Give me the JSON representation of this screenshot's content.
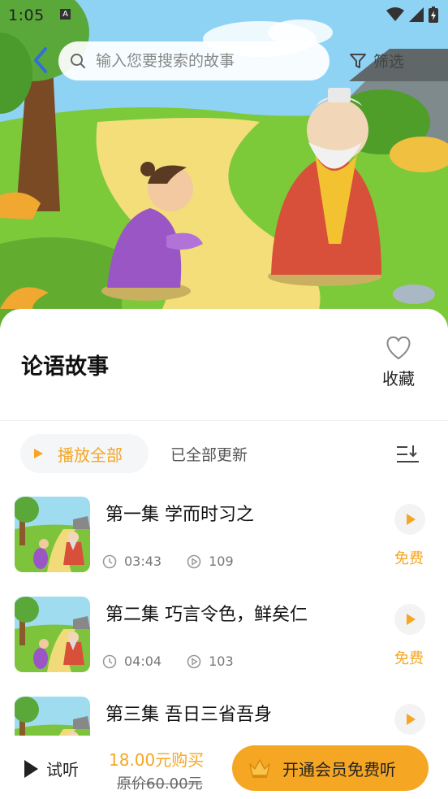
{
  "status_bar": {
    "time": "1:05",
    "notification_icon": "A"
  },
  "search": {
    "placeholder": "输入您要搜索的故事"
  },
  "filter_label": "筛选",
  "story": {
    "title": "论语故事",
    "favorite_label": "收藏"
  },
  "controls": {
    "play_all_label": "播放全部",
    "update_status": "已全部更新"
  },
  "episodes": [
    {
      "title": "第一集 学而时习之",
      "duration": "03:43",
      "plays": "109",
      "badge": "免费"
    },
    {
      "title": "第二集 巧言令色，鲜矣仁",
      "duration": "04:04",
      "plays": "103",
      "badge": "免费"
    },
    {
      "title": "第三集 吾日三省吾身",
      "duration": "",
      "plays": "",
      "badge": ""
    }
  ],
  "bottom_bar": {
    "trial_label": "试听",
    "price": "18.00元购买",
    "original_price": "原价60.00元",
    "vip_label": "开通会员免费听"
  },
  "colors": {
    "accent": "#f5a623"
  }
}
